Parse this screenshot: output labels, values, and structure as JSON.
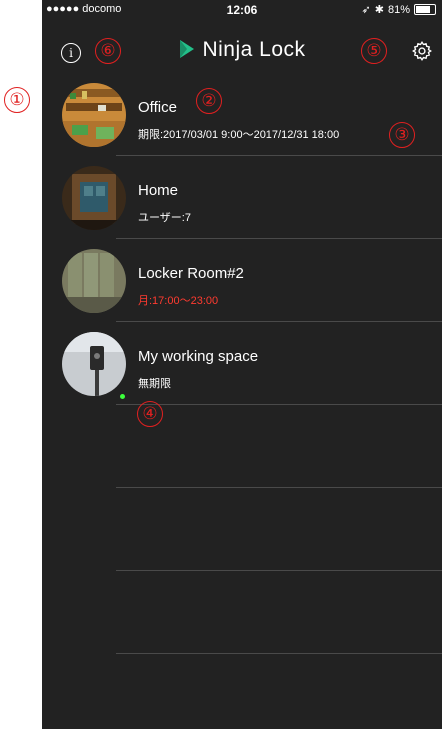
{
  "status_bar": {
    "carrier": "●●●●● docomo",
    "time": "12:06",
    "battery": "81%",
    "battery_level": 0.81
  },
  "nav": {
    "brand": "Ninja Lock",
    "info_glyph": "i"
  },
  "locks": [
    {
      "name": "Office",
      "detail": "期限:2017/03/01 9:00〜2017/12/31 18:00",
      "detail_color": "#ffffff",
      "online": false
    },
    {
      "name": "Home",
      "detail": "ユーザー:7",
      "detail_color": "#ffffff",
      "online": false
    },
    {
      "name": "Locker Room#2",
      "detail": "月:17:00〜23:00",
      "detail_color": "#ff3b30",
      "online": false
    },
    {
      "name": "My working space",
      "detail": "無期限",
      "detail_color": "#ffffff",
      "online": true
    }
  ],
  "annotations": [
    "①",
    "②",
    "③",
    "④",
    "⑤",
    "⑥"
  ],
  "colors": {
    "background": "#222222",
    "accent_red": "#e02020",
    "online_green": "#3cff3c",
    "logo_green": "#23c08a"
  },
  "icons": [
    "wifi-icon",
    "location-arrow-icon",
    "bluetooth-icon",
    "battery-icon",
    "info-icon",
    "ninja-lock-logo-icon",
    "settings-gear-icon"
  ]
}
